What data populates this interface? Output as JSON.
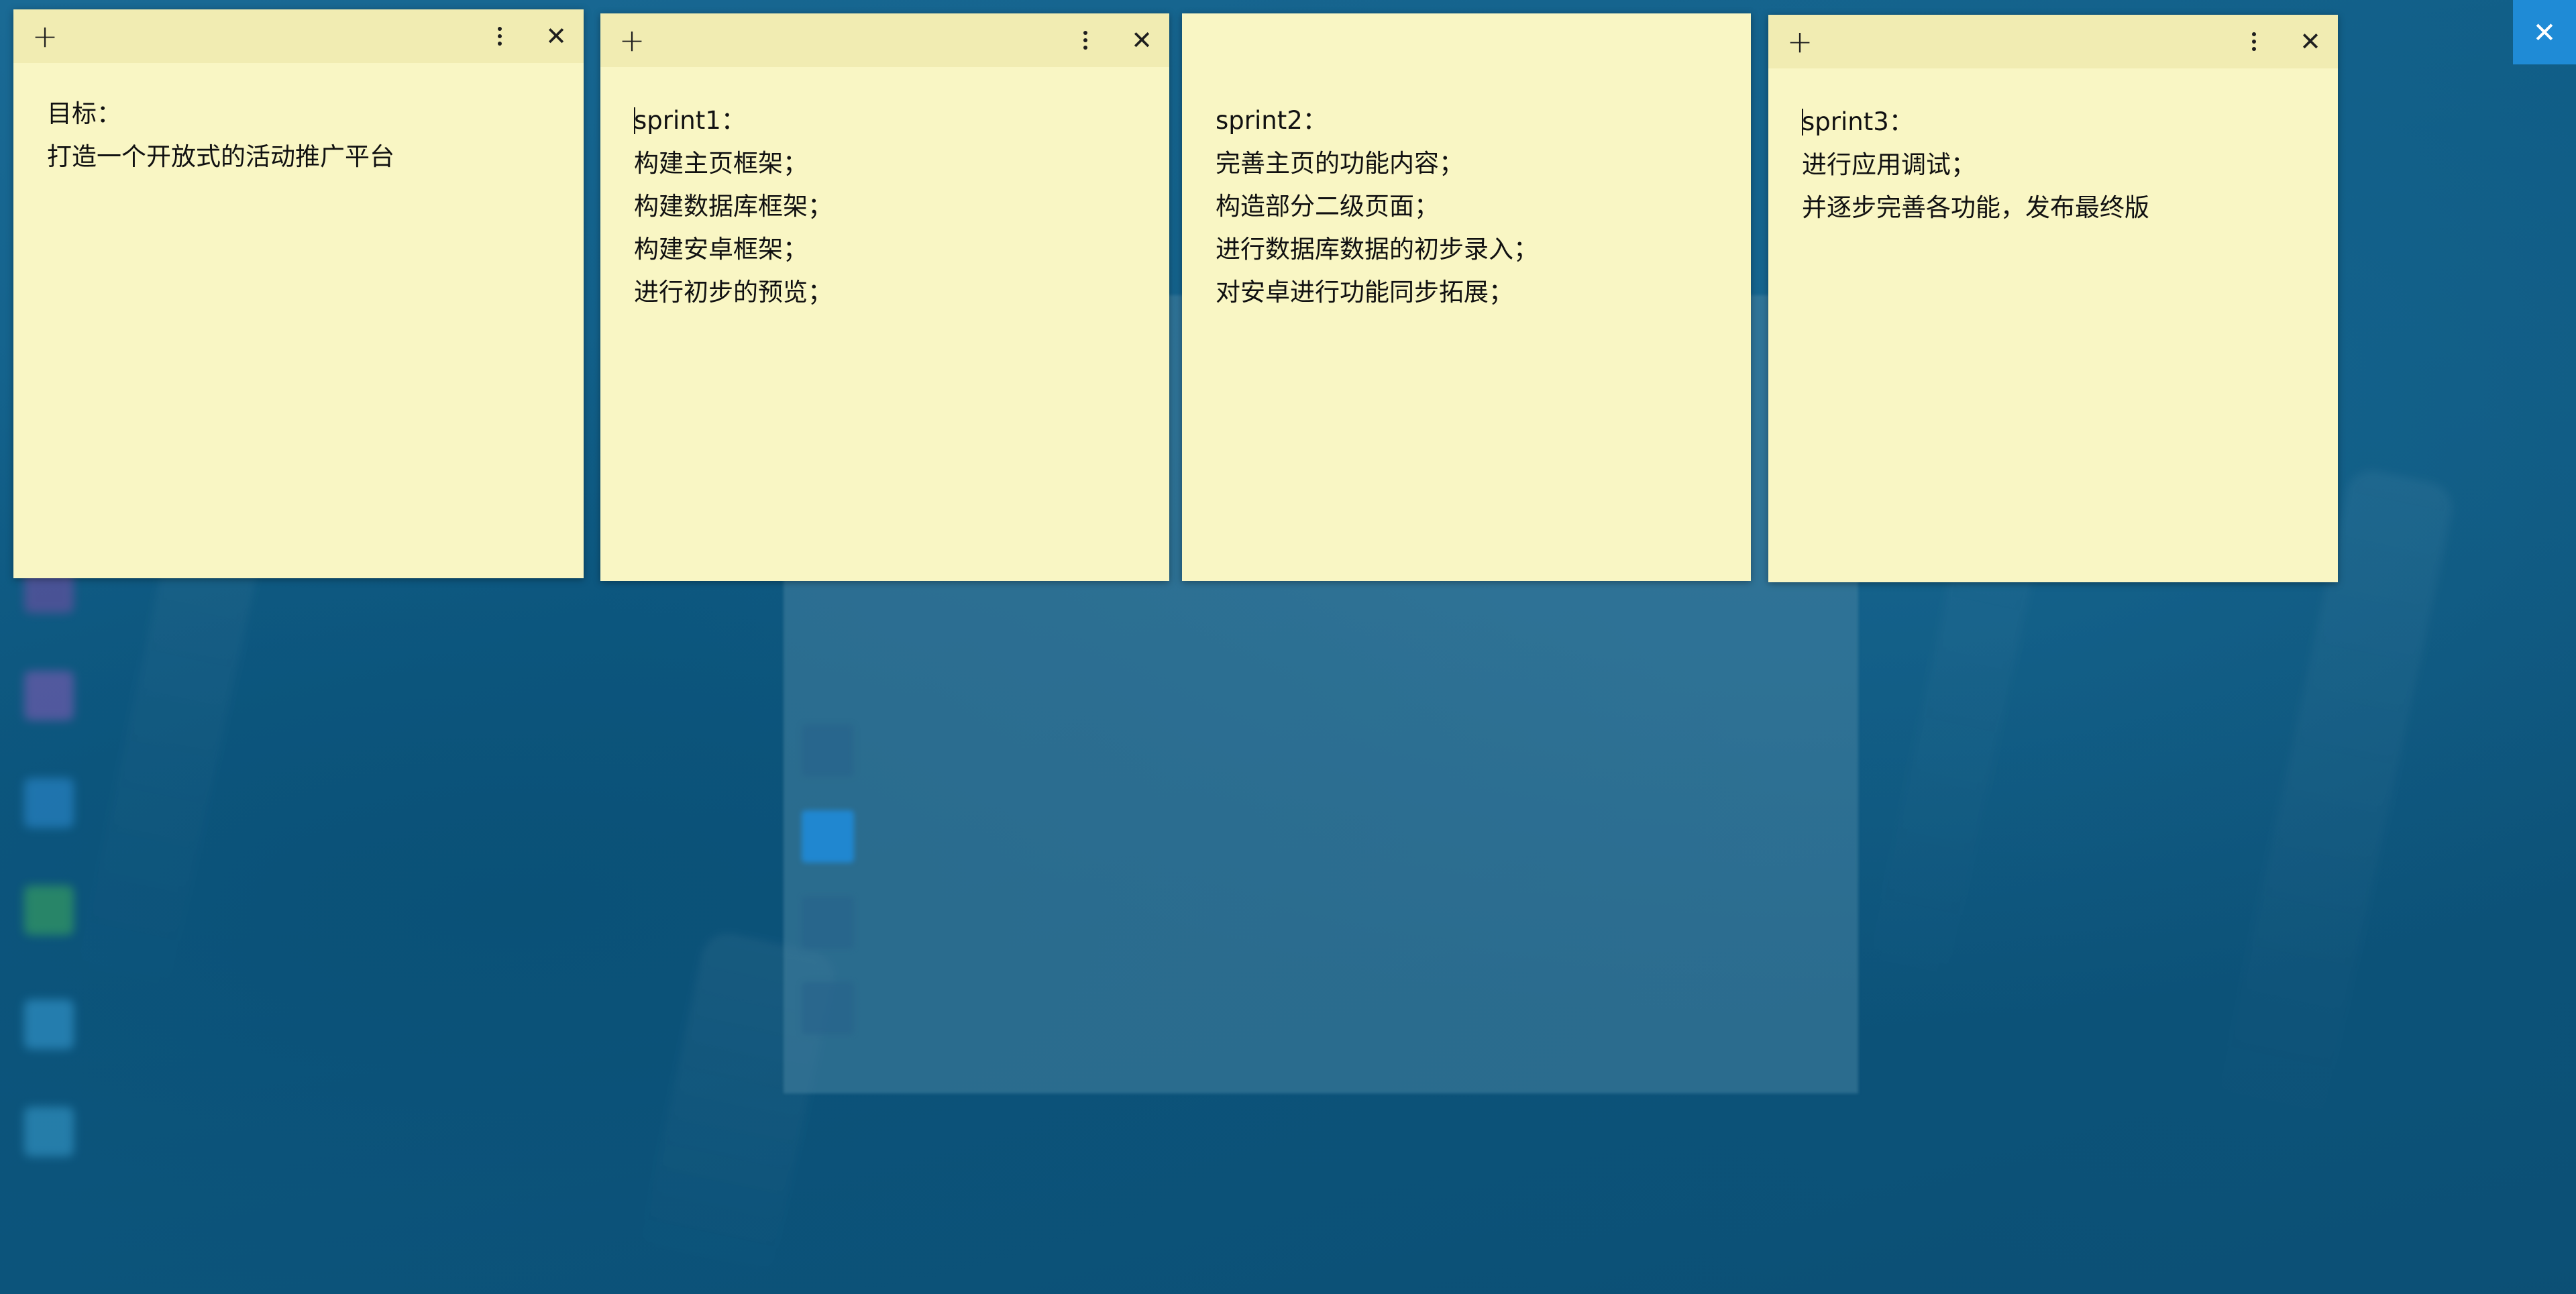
{
  "notes": [
    {
      "has_header": true,
      "lines": [
        "目标：",
        "打造一个开放式的活动推广平台"
      ]
    },
    {
      "has_header": true,
      "lines": [
        "sprint1：",
        "构建主页框架；",
        "构建数据库框架；",
        "构建安卓框架；",
        "进行初步的预览；"
      ]
    },
    {
      "has_header": false,
      "lines": [
        "sprint2：",
        "完善主页的功能内容；",
        "构造部分二级页面；",
        "进行数据库数据的初步录入；",
        "对安卓进行功能同步拓展；"
      ]
    },
    {
      "has_header": true,
      "lines": [
        "sprint3：",
        "进行应用调试；",
        "并逐步完善各功能，发布最终版"
      ]
    }
  ],
  "icons": {
    "add": "+",
    "close": "✕",
    "menu": "more-vertical-icon"
  },
  "colors": {
    "note_body": "#f9f6c4",
    "note_header": "#f1ecb2",
    "desktop": "#0f5a82",
    "accent": "#1f8bd6"
  }
}
